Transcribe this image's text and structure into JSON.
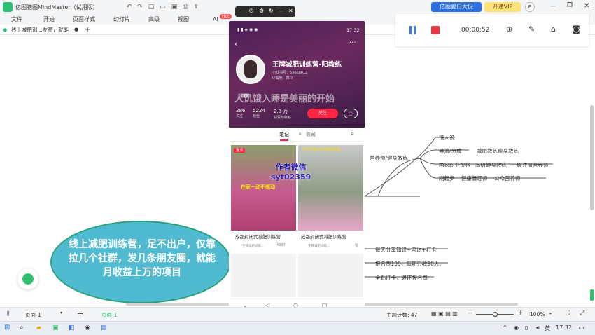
{
  "app": {
    "title": "亿图脑图MindMaster（试用版）",
    "promo_label": "亿图夏日大促",
    "vip_label": "开通VIP",
    "user_initial": "E"
  },
  "menu": [
    "文件",
    "开始",
    "页面样式",
    "幻灯片",
    "高级",
    "视图",
    "AI"
  ],
  "menu_badge": "Hot",
  "doc_tab": {
    "label": "线上减肥训...友圈，就能"
  },
  "recorder": {
    "time": "00:00:52"
  },
  "phone": {
    "status_time": "17:32",
    "profile_name": "王牌减肥训练营-阳教练",
    "profile_sub1": "小红书号：53668012",
    "profile_sub2": "IP属地：四川",
    "banner_text": "人饥饿入睡是美丽的开始",
    "age_badge": "28岁",
    "stats": [
      {
        "value": "286",
        "label": "关注"
      },
      {
        "value": "5224",
        "label": "粉丝"
      },
      {
        "value": "2.8 万",
        "label": "获赞与收藏"
      }
    ],
    "follow_label": "关注",
    "tabs": [
      "笔记",
      "收藏"
    ],
    "cards": [
      {
        "tag": "置顶",
        "caption_overlay": "在家一动不想动",
        "title": "成都封闭式减肥训练营",
        "author": "王牌减肥训练…",
        "likes": "4397"
      },
      {
        "tag": "",
        "caption_overlay": "世界小姐北京中国体验营",
        "title": "成都封闭式减肥训练营",
        "author": "王牌减肥训练…",
        "likes": "赞"
      }
    ],
    "watermark_line1": "作者微信",
    "watermark_line2": "syt02359"
  },
  "mindmap": {
    "branch_main": "营养师/健身教练",
    "nodes": [
      {
        "text": "懂人设"
      },
      {
        "text": "导流/分成"
      },
      {
        "text": "减肥教练瘦身教练"
      },
      {
        "text": "国家职业资格"
      },
      {
        "text": "高级健身教练"
      },
      {
        "text": "一级注册营养师"
      },
      {
        "text": "刚起步"
      },
      {
        "text": "健康管理师"
      },
      {
        "text": "公众营养师"
      },
      {
        "text": "每天分享知识+咨询+打卡"
      },
      {
        "text": "报名费199，每期只收30人。"
      },
      {
        "text": "全勤打卡，退还报名费"
      }
    ],
    "central_topic": "线上减肥训练营，足不出户，仅靠拉几个社群，发几条朋友圈，就能月收益上万的项目"
  },
  "statusbar": {
    "page_select": "页面-1",
    "page_tab": "页面-1",
    "topic_count_label": "主题计数: 47",
    "zoom": "100%",
    "zoom_level": 0.5
  },
  "taskbar": {
    "ime": "英",
    "time": "17:32"
  },
  "colors": {
    "accent": "#2fbf71",
    "bubble": "#4fbad0",
    "record": "#e63946",
    "pause": "#3b7ddd",
    "follow": "#ff2442"
  }
}
